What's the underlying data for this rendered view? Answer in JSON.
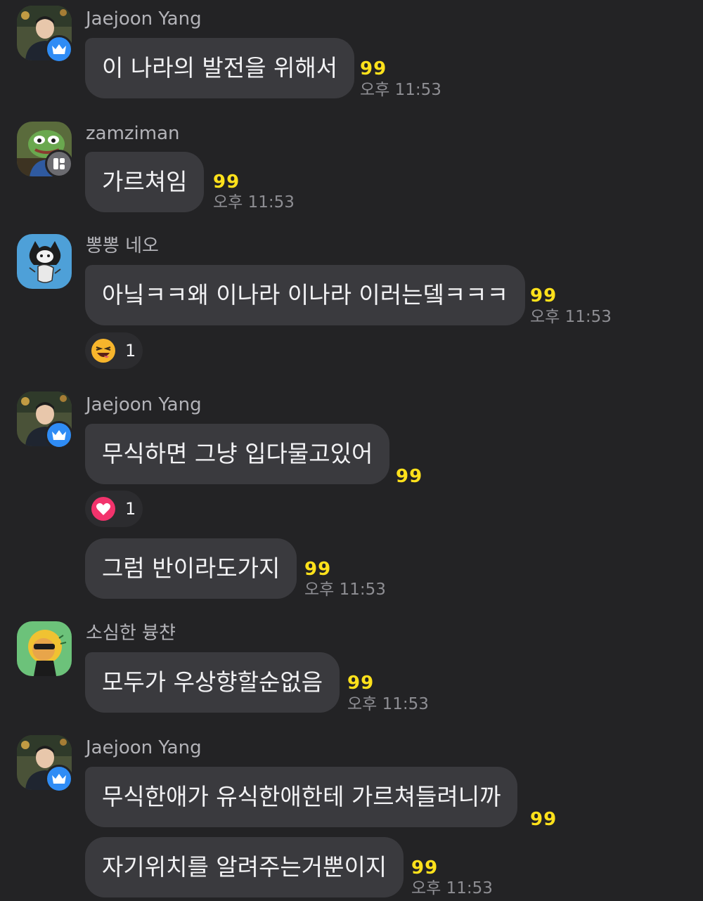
{
  "messages": [
    {
      "sender": "Jaejoon Yang",
      "avatar_icon": "profile-photo-man-icon",
      "badge_icon": "crown-icon",
      "bubbles": [
        {
          "text": "이 나라의 발전을 위해서",
          "unread": "99",
          "time": "오후 11:53"
        }
      ]
    },
    {
      "sender": "zamziman",
      "avatar_icon": "frog-meme-icon",
      "badge_icon": "manager-icon",
      "bubbles": [
        {
          "text": "가르쳐임",
          "unread": "99",
          "time": "오후 11:53"
        }
      ]
    },
    {
      "sender": "뽕뽕 네오",
      "avatar_icon": "cartoon-cat-icon",
      "bubbles": [
        {
          "text": "아닠ㅋㅋ왜 이나라 이나라 이러는뎈ㅋㅋㅋ",
          "unread": "99",
          "time": "오후 11:53",
          "reaction": {
            "icon": "laughing-emoji-icon",
            "count": "1"
          }
        }
      ]
    },
    {
      "sender": "Jaejoon Yang",
      "avatar_icon": "profile-photo-man-icon",
      "badge_icon": "crown-icon",
      "bubbles": [
        {
          "text": "무식하면 그냥 입다물고있어",
          "unread": "99",
          "reaction": {
            "icon": "heart-icon",
            "count": "1"
          }
        },
        {
          "text": "그럼 반이라도가지",
          "unread": "99",
          "time": "오후 11:53"
        }
      ]
    },
    {
      "sender": "소심한 븅챤",
      "avatar_icon": "cartoon-lion-icon",
      "bubbles": [
        {
          "text": "모두가 우상향할순없음",
          "unread": "99",
          "time": "오후 11:53"
        }
      ]
    },
    {
      "sender": "Jaejoon Yang",
      "avatar_icon": "profile-photo-man-icon",
      "badge_icon": "crown-icon",
      "bubbles": [
        {
          "text": "무식한애가  유식한애한테 가르쳐들려니까",
          "unread": "99"
        },
        {
          "text": "자기위치를 알려주는거뿐이지",
          "unread": "99",
          "time": "오후 11:53"
        }
      ]
    }
  ],
  "colors": {
    "background": "#232325",
    "bubble": "#3a3a3e",
    "unread": "#ffe11b",
    "badge": "#2f8cf5"
  }
}
